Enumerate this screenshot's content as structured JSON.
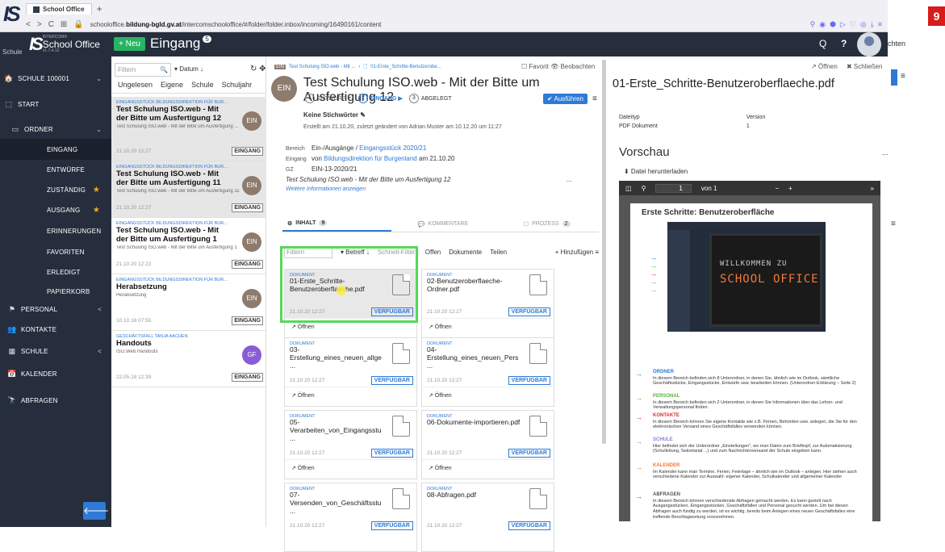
{
  "browser": {
    "tab_label": "School Office",
    "new_tab": "+",
    "url_prefix": "schooloffice.",
    "url_domain": "bildung-bgld.gv.at",
    "url_path": "/intercomschooloffice/#/folder/folder.inbox/incoming/16490161/content"
  },
  "header": {
    "logo_top": "IS",
    "app_brand_small": "INTERCOM®",
    "app_brand": "School Office",
    "app_version": "v1.7.4.12",
    "schul": "Schule",
    "new_button": "+ Neu",
    "title": "Eingang",
    "title_count": "5",
    "search": "Q",
    "help": "?",
    "right_cut_text": "chten",
    "corner_badge": "9"
  },
  "nav": {
    "items": [
      {
        "icon": "🏠",
        "label": "Schule  100001",
        "chev": "⌄"
      },
      {
        "icon": "⬚",
        "label": "Start"
      },
      {
        "icon": "▭",
        "label": "Ordner",
        "chev": "⌄"
      },
      {
        "icon": "",
        "label": "Eingang"
      },
      {
        "icon": "",
        "label": "Entwürfe"
      },
      {
        "icon": "",
        "label": "Zuständig",
        "star": "★"
      },
      {
        "icon": "",
        "label": "Ausgang",
        "star": "★"
      },
      {
        "icon": "",
        "label": "Erinnerungen"
      },
      {
        "icon": "",
        "label": "Favoriten"
      },
      {
        "icon": "",
        "label": "Erledigt"
      },
      {
        "icon": "",
        "label": "Papierkorb"
      },
      {
        "icon": "⚑",
        "label": "Personal",
        "chev": "<"
      },
      {
        "icon": "👥",
        "label": "Kontakte"
      },
      {
        "icon": "▦",
        "label": "Schule",
        "chev": "<"
      },
      {
        "icon": "📅",
        "label": "Kalender"
      },
      {
        "icon": "🔭",
        "label": "Abfragen"
      }
    ],
    "collapse": "🡐"
  },
  "list": {
    "filter_placeholder": "Filtern",
    "sort": "▾ Datum  ↓",
    "chips": [
      "Ungelesen",
      "Eigene",
      "Schule",
      "Schuljahr"
    ],
    "items": [
      {
        "from": "EINGANGSSTÜCK BILDUNGSDIREKTION FÜR BUR...",
        "subject": "Test Schulung ISO.web - Mit der Bitte um Ausfertigung 12",
        "snippet": "Test Schulung ISO.web - Mit der Bitte um Ausfertigung ...",
        "date": "21.10.20 12:27",
        "tag": "EINGANG",
        "avatar": "EIN",
        "avatar_color": "#8d7b6e"
      },
      {
        "from": "EINGANGSSTÜCK BILDUNGSDIREKTION FÜR BUR...",
        "subject": "Test Schulung ISO.web - Mit der Bitte um Ausfertigung 11",
        "snippet": "Test Schulung ISO.web - Mit der Bitte um Ausfertigung 11",
        "date": "21.10.20 12:27",
        "tag": "EINGANG",
        "avatar": "EIN",
        "avatar_color": "#8d7b6e"
      },
      {
        "from": "EINGANGSSTÜCK BILDUNGSDIREKTION FÜR BUR...",
        "subject": "Test Schulung ISO.web - Mit der Bitte um Ausfertigung 1",
        "snippet": "Test Schulung ISO.web - Mit der Bitte um Ausfertigung 1",
        "date": "21.10.20 12:23",
        "tag": "EINGANG",
        "avatar": "EIN",
        "avatar_color": "#8d7b6e"
      },
      {
        "from": "EINGANGSSTÜCK BILDUNGSDIREKTION FÜR BUR...",
        "subject": "Herabsetzung",
        "snippet": "Herabsetzung",
        "date": "10.10.18 07:55",
        "tag": "EINGANG",
        "avatar": "EIN",
        "avatar_color": "#8d7b6e"
      },
      {
        "from": "GESCHÄFTSFALL TANJA AACHEN",
        "subject": "Handouts",
        "snippet": "ISO.Web Handouts",
        "date": "22.05.18 12:39",
        "tag": "EINGANG",
        "avatar": "GF",
        "avatar_color": "#8a5cd6"
      }
    ]
  },
  "main": {
    "breadcrumb": {
      "tag": "EIN",
      "item1": "Test Schulung ISO.web - Mit ...",
      "sep": "›",
      "item2": "01-Erste_Schritte-Benutzerobe..."
    },
    "favorit": "☐ Favorit   👁 Beobachten",
    "avatar": "EIN",
    "title": "Test Schulung ISO.web - Mit der Bitte um Ausfertigung 12",
    "steps": [
      {
        "n": "1",
        "label": "Entwurf ✔"
      },
      {
        "n": "2",
        "label": "Eingang ▶"
      },
      {
        "n": "3",
        "label": "Abgelegt"
      }
    ],
    "ausfuehren": "✔ Ausführen",
    "menu": "≡",
    "stichwoerter": "Keine Stichwörter  ✎",
    "erstellt": "Erstellt am 21.10.20, zuletzt geändert von Adrian Muster am 10.12.20 um 11:27",
    "bereich_k": "Bereich",
    "bereich_v1": "Ein-/Ausgänge / ",
    "bereich_v2": "Eingangsstück 2020/21",
    "eingang_k": "Eingang",
    "eingang_v1": "von ",
    "eingang_v2": "Bildungsdirektion für Burgenland",
    "eingang_v3": " am 21.10.20",
    "gz_k": "GZ",
    "gz_v": "EIN-13-2020/21",
    "subject_it": "Test Schulung ISO.web - Mit der Bitte um Ausfertigung 12",
    "dots": "...",
    "weitere": "Weitere Informationen anzeigen",
    "tabs": [
      {
        "label": "Inhalt",
        "count": "9"
      },
      {
        "label": "Kommentare",
        "count": ""
      },
      {
        "label": "Prozess",
        "count": "2"
      }
    ],
    "toolbar": {
      "filter": "Filtern",
      "sort": "▾ Betreff  ↓",
      "schnell": "Schnell-Filter:",
      "offen": "Offen",
      "dokumente": "Dokumente",
      "teilen": "Teilen",
      "hinzu": "+ Hinzufügen  ≡"
    },
    "cards": [
      {
        "lbl": "DOKUMENT",
        "name": "01-Erste_Schritte-Benutzeroberflaeche.pdf",
        "date": "21.10.20 12:27",
        "status": "VERFÜGBAR",
        "open": "↗ Öffnen"
      },
      {
        "lbl": "DOKUMENT",
        "name": "02-Benutzeroberflaeche-Ordner.pdf",
        "date": "21.10.20 12:27",
        "status": "VERFÜGBAR",
        "open": "↗ Öffnen"
      },
      {
        "lbl": "DOKUMENT",
        "name": "03-Erstellung_eines_neuen_allge ...",
        "date": "21.10.20 12:27",
        "status": "VERFÜGBAR",
        "open": "↗ Öffnen"
      },
      {
        "lbl": "DOKUMENT",
        "name": "04-Erstellung_eines_neuen_Pers ...",
        "date": "21.10.20 12:27",
        "status": "VERFÜGBAR",
        "open": "↗ Öffnen"
      },
      {
        "lbl": "DOKUMENT",
        "name": "05-Verarbeiten_von_Eingangsstu ...",
        "date": "21.10.20 12:27",
        "status": "VERFÜGBAR",
        "open": "↗ Öffnen"
      },
      {
        "lbl": "DOKUMENT",
        "name": "06-Dokumente-importieren.pdf",
        "date": "21.10.20 12:27",
        "status": "VERFÜGBAR",
        "open": "↗ Öffnen"
      },
      {
        "lbl": "DOKUMENT",
        "name": "07-Versenden_von_Geschäftsstu ...",
        "date": "21.10.20 12:27",
        "status": "VERFÜGBAR",
        "open": ""
      },
      {
        "lbl": "DOKUMENT",
        "name": "08-Abfragen.pdf",
        "date": "21.10.20 12:27",
        "status": "VERFÜGBAR",
        "open": ""
      }
    ]
  },
  "preview": {
    "open": "↗ Öffnen",
    "close": "✖ Schließen",
    "title": "01-Erste_Schritte-Benutzeroberflaeche.pdf",
    "dateityp_k": "Dateityp",
    "dateityp_v": "PDF Dokument",
    "version_k": "Version",
    "version_v": "1",
    "vorschau": "Vorschau",
    "dots": "...",
    "download": "⬇ Datei herunterladen",
    "pdf_page": "1",
    "pdf_of": "von 1",
    "pdf_zoom_out": "−",
    "pdf_zoom_in": "+",
    "pdf_more": "»",
    "page_title": "Erste Schritte: Benutzeroberfläche",
    "welcome1": "WILLKOMMEN ZU",
    "welcome2": "SCHOOL OFFICE",
    "sections": [
      {
        "head": "ORDNER",
        "text": "In diesem Bereich befinden sich 8 Unterordner, in denen Sie, ähnlich wie im Outlook, sämtliche Geschäftsstücke, Eingangsstücke, Entwürfe usw. bearbeiten können. (Unterordner-Erklärung – Seite 2)",
        "color": "#2e7ad6"
      },
      {
        "head": "PERSONAL",
        "text": "In diesem Bereich befinden sich 2 Unterordner, in denen Sie Informationen über das Lehrer- und Verwaltungspersonal finden.",
        "color": "#55b83a"
      },
      {
        "head": "KONTAKTE",
        "text": "In diesem Bereich können Sie eigene Kontakte wie z.B. Firmen, Behörden usw. anlegen, die Sie für den elektronischen Versand eines Geschäftsfalles verwenden können.",
        "color": "#d62e2e"
      },
      {
        "head": "SCHULE",
        "text": "Hier befindet sich der Unterordner „Einstellungen\", wo man Daten zum Briefkopf, zur Automatisierung (Schulleitung, Sekretariat ...) und zum Nachrichtenversand der Schule eingeben kann.",
        "color": "#8a7bd6"
      },
      {
        "head": "KALENDER",
        "text": "Im Kalender kann man Termine, Ferien, Feiertage – ähnlich wie im Outlook – anlegen. Hier stehen auch verschiedene Kalender zur Auswahl: eigener Kalender, Schulkalender und allgemeiner Kalender",
        "color": "#f07a3a"
      },
      {
        "head": "ABFRAGEN",
        "text": "In diesem Bereich können verschiedenste Abfragen gemacht werden. Es kann gezielt nach Ausgangsstücken, Eingangsstücken, Geschäftsfällen und Personal gesucht werden. Um bei diesen Abfragen auch fündig zu werden, ist es wichtig, bereits beim Anlegen eines neuen Geschäftsfalles eine treffende Beschlagwortung vorzunehmen.",
        "color": "#555555"
      }
    ]
  }
}
